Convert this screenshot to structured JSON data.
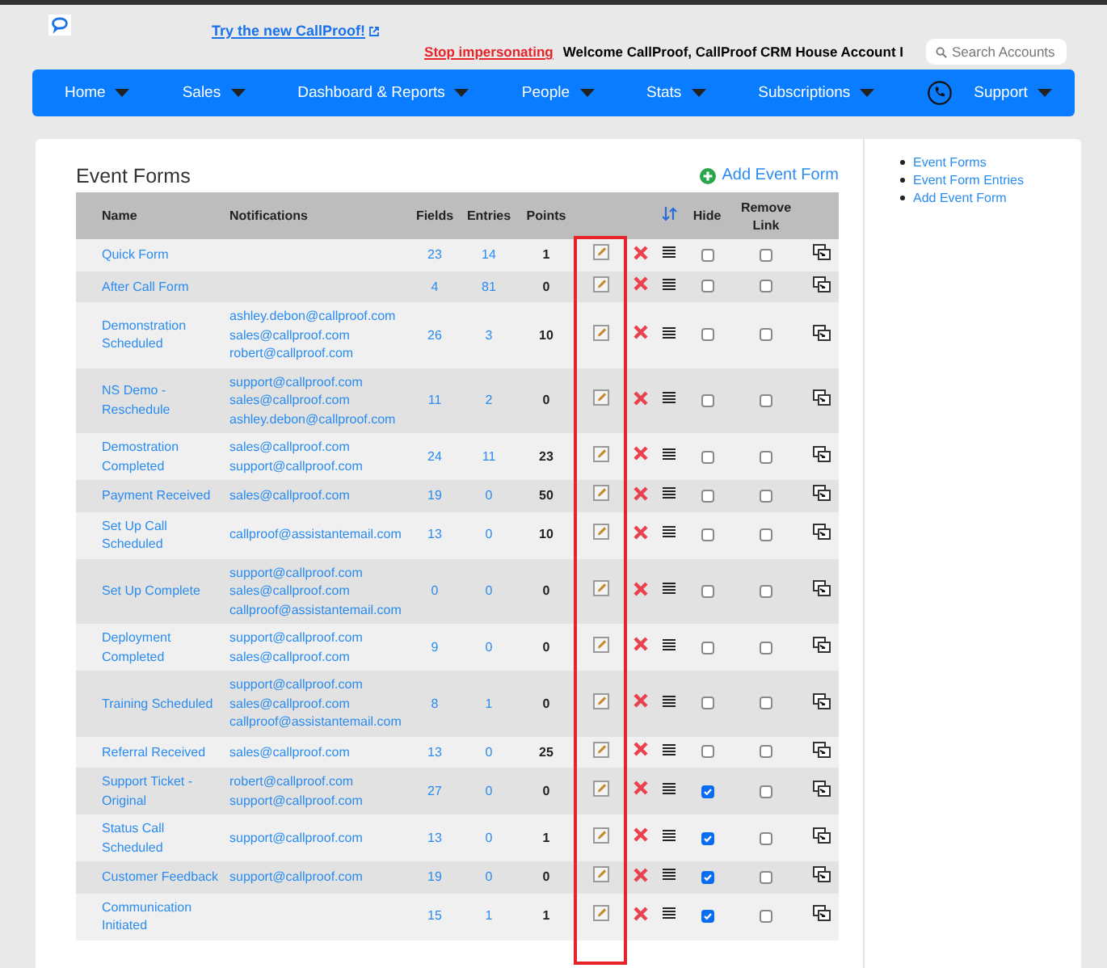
{
  "header": {
    "try_link": "Try the new CallProof!",
    "stop_link": "Stop impersonating",
    "welcome": "Welcome CallProof, CallProof CRM House Account I",
    "search": {
      "placeholder": "Search Accounts"
    }
  },
  "nav": [
    {
      "label": "Home"
    },
    {
      "label": "Sales"
    },
    {
      "label": "Dashboard & Reports"
    },
    {
      "label": "People"
    },
    {
      "label": "Stats"
    },
    {
      "label": "Subscriptions"
    },
    {
      "label": "Support",
      "phone": true
    }
  ],
  "page_title": "Event Forms",
  "add_button": "Add Event Form",
  "table": {
    "columns": [
      "Name",
      "Notifications",
      "Fields",
      "Entries",
      "Points",
      "Hide",
      "Remove Link"
    ],
    "rows": [
      {
        "name": "Quick Form",
        "notifications": [],
        "fields": "23",
        "entries": "14",
        "points": "1",
        "hide": false,
        "remove_link": false
      },
      {
        "name": "After Call Form",
        "notifications": [],
        "fields": "4",
        "entries": "81",
        "points": "0",
        "hide": false,
        "remove_link": false
      },
      {
        "name": "Demonstration Scheduled",
        "notifications": [
          "ashley.debon@callproof.com",
          "sales@callproof.com",
          "robert@callproof.com"
        ],
        "fields": "26",
        "entries": "3",
        "points": "10",
        "hide": false,
        "remove_link": false
      },
      {
        "name": "NS Demo - Reschedule",
        "notifications": [
          "support@callproof.com",
          "sales@callproof.com",
          "ashley.debon@callproof.com"
        ],
        "fields": "11",
        "entries": "2",
        "points": "0",
        "hide": false,
        "remove_link": false
      },
      {
        "name": "Demostration Completed",
        "notifications": [
          "sales@callproof.com",
          "support@callproof.com"
        ],
        "fields": "24",
        "entries": "11",
        "points": "23",
        "hide": false,
        "remove_link": false
      },
      {
        "name": "Payment Received",
        "notifications": [
          "sales@callproof.com"
        ],
        "fields": "19",
        "entries": "0",
        "points": "50",
        "hide": false,
        "remove_link": false
      },
      {
        "name": "Set Up Call Scheduled",
        "notifications": [
          "callproof@assistantemail.com"
        ],
        "fields": "13",
        "entries": "0",
        "points": "10",
        "hide": false,
        "remove_link": false
      },
      {
        "name": "Set Up Complete",
        "notifications": [
          "support@callproof.com",
          "sales@callproof.com",
          "callproof@assistantemail.com"
        ],
        "fields": "0",
        "entries": "0",
        "points": "0",
        "hide": false,
        "remove_link": false
      },
      {
        "name": "Deployment Completed",
        "notifications": [
          "support@callproof.com",
          "sales@callproof.com"
        ],
        "fields": "9",
        "entries": "0",
        "points": "0",
        "hide": false,
        "remove_link": false
      },
      {
        "name": "Training Scheduled",
        "notifications": [
          "support@callproof.com",
          "sales@callproof.com",
          "callproof@assistantemail.com"
        ],
        "fields": "8",
        "entries": "1",
        "points": "0",
        "hide": false,
        "remove_link": false
      },
      {
        "name": "Referral Received",
        "notifications": [
          "sales@callproof.com"
        ],
        "fields": "13",
        "entries": "0",
        "points": "25",
        "hide": false,
        "remove_link": false
      },
      {
        "name": "Support Ticket - Original",
        "notifications": [
          "robert@callproof.com",
          "support@callproof.com"
        ],
        "fields": "27",
        "entries": "0",
        "points": "0",
        "hide": true,
        "remove_link": false
      },
      {
        "name": "Status Call Scheduled",
        "notifications": [
          "support@callproof.com"
        ],
        "fields": "13",
        "entries": "0",
        "points": "1",
        "hide": true,
        "remove_link": false
      },
      {
        "name": "Customer Feedback",
        "notifications": [
          "support@callproof.com"
        ],
        "fields": "19",
        "entries": "0",
        "points": "0",
        "hide": true,
        "remove_link": false
      },
      {
        "name": "Communication Initiated",
        "notifications": [],
        "fields": "15",
        "entries": "1",
        "points": "1",
        "hide": true,
        "remove_link": false
      }
    ]
  },
  "sidebar": {
    "items": [
      {
        "label": "Event Forms"
      },
      {
        "label": "Event Form Entries"
      },
      {
        "label": "Add Event Form"
      }
    ]
  }
}
